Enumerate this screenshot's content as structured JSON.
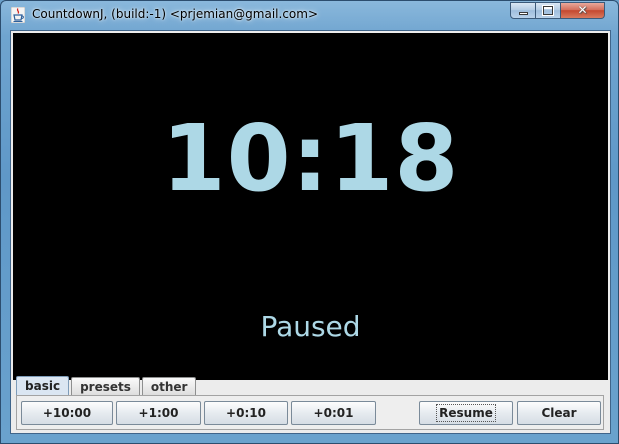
{
  "window": {
    "title": "CountdownJ, (build:-1) <prjemian@gmail.com>",
    "app_icon": "java-cup-icon",
    "controls": {
      "minimize": "minimize-icon",
      "maximize": "maximize-icon",
      "close_glyph": "✕"
    }
  },
  "display": {
    "time": "10:18",
    "status": "Paused",
    "background_color": "#000000",
    "text_color": "#add8e6"
  },
  "tabs": [
    {
      "label": "basic",
      "selected": true
    },
    {
      "label": "presets",
      "selected": false
    },
    {
      "label": "other",
      "selected": false
    }
  ],
  "buttons": {
    "add_10_min": "+10:00",
    "add_1_min": "+1:00",
    "add_10_sec": "+0:10",
    "add_1_sec": "+0:01",
    "resume": "Resume",
    "clear": "Clear"
  }
}
